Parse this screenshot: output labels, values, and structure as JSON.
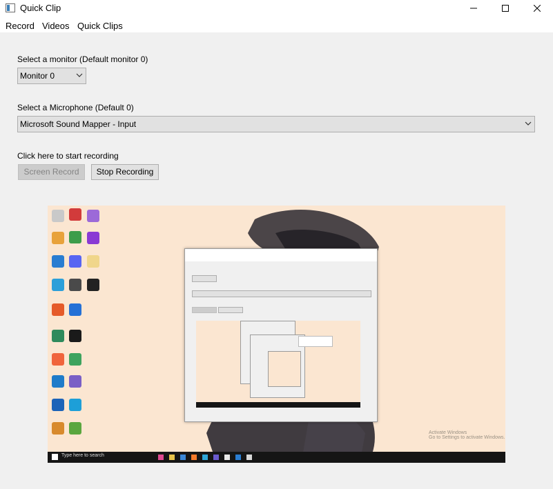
{
  "window": {
    "title": "Quick Clip",
    "controls": {
      "minimize_glyph": "—",
      "maximize_glyph": "☐",
      "close_glyph": "✕"
    }
  },
  "menu": {
    "items": [
      {
        "label": "Record"
      },
      {
        "label": "Videos"
      },
      {
        "label": "Quick Clips"
      }
    ]
  },
  "monitor": {
    "label": "Select a monitor (Default monitor 0)",
    "selected": "Monitor 0"
  },
  "microphone": {
    "label": "Select a Microphone (Default 0)",
    "selected": "Microsoft Sound Mapper - Input"
  },
  "recording": {
    "label": "Click here to start recording",
    "screen_record_label": "Screen Record",
    "screen_record_enabled": false,
    "stop_label": "Stop Recording"
  },
  "preview": {
    "description_icon": "live-screen-preview",
    "taskbar_search_placeholder": "Type here to search",
    "watermark_line1": "Activate Windows",
    "watermark_line2": "Go to Settings to activate Windows."
  },
  "colors": {
    "window_bg": "#f0f0f0",
    "control_bg": "#e1e1e1",
    "control_border": "#adadad",
    "disabled_text": "#838383",
    "preview_bg": "#fbe6d1",
    "taskbar": "#151515"
  }
}
